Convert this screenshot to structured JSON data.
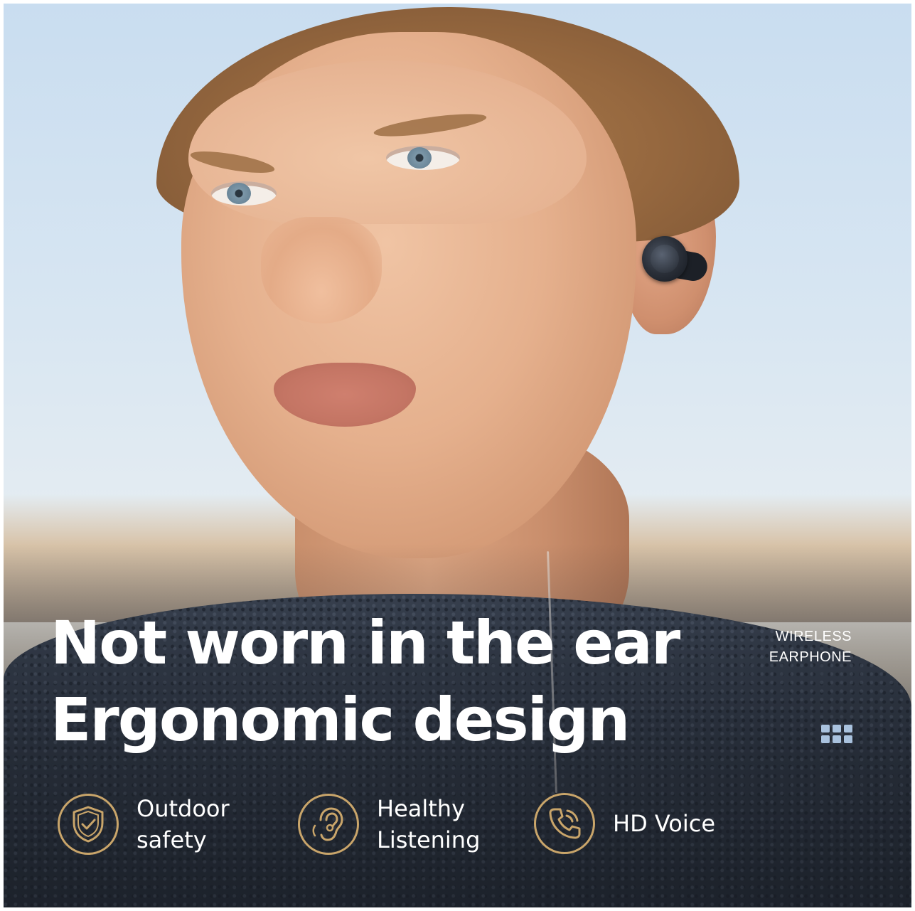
{
  "headline": {
    "line1": "Not worn in the ear",
    "line2": "Ergonomic design"
  },
  "brand": {
    "line1": "WIRELESS",
    "line2": "EARPHONE"
  },
  "features": [
    {
      "icon": "shield-check-icon",
      "line1": "Outdoor",
      "line2": "safety"
    },
    {
      "icon": "ear-icon",
      "line1": "Healthy",
      "line2": "Listening"
    },
    {
      "icon": "phone-icon",
      "line1": "HD Voice",
      "line2": ""
    }
  ],
  "colors": {
    "accent_gold": "#c9a56a",
    "grid_icon": "#a9c2de",
    "text": "#ffffff"
  }
}
